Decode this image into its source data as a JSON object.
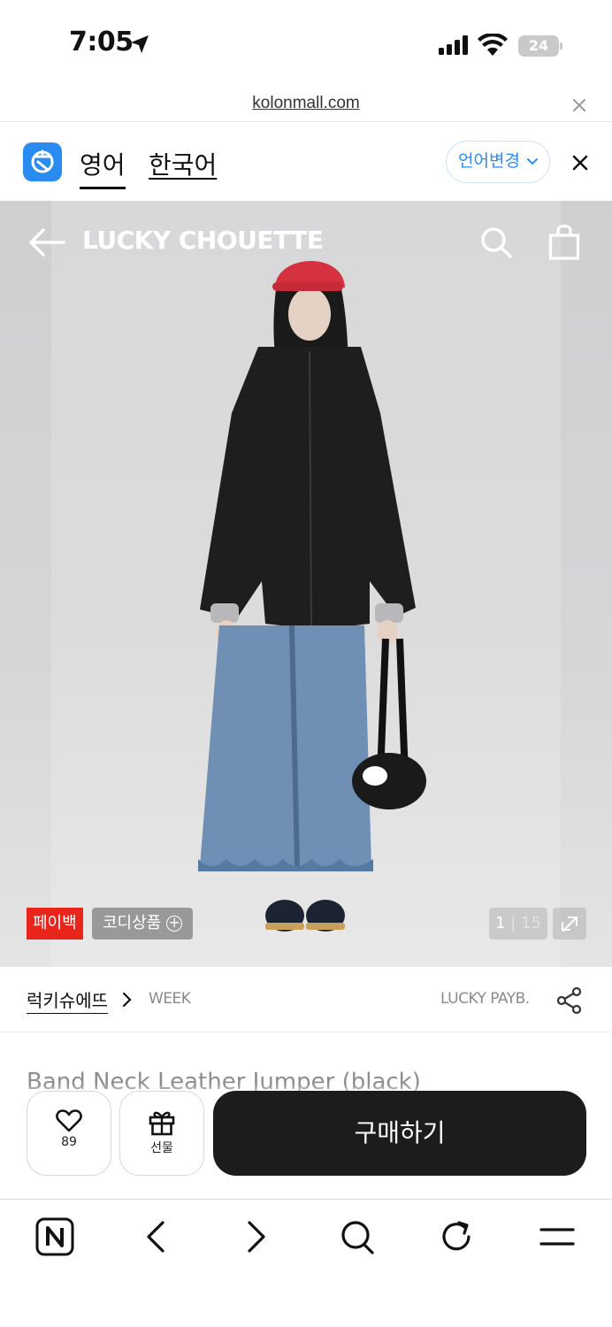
{
  "status_bar": {
    "time": "7:05",
    "battery": "24"
  },
  "url_bar": {
    "domain": "kolonmall.com"
  },
  "translate_bar": {
    "source_language": "영어",
    "target_language": "한국어",
    "change_language_label": "언어변경"
  },
  "header": {
    "brand_title": "LUCKY CHOUETTE"
  },
  "hero": {
    "payback_badge": "페이백",
    "codi_label": "코디상품",
    "current_image": "1",
    "image_separator": " | ",
    "total_images": "15"
  },
  "product_info": {
    "brand_name": "럭키슈에뜨",
    "season_label": "WEEK",
    "payback_label": "LUCKY PAYB.",
    "title": "Band Neck Leather Jumper (black)"
  },
  "actions": {
    "like_count": "89",
    "gift_label": "선물",
    "buy_label": "구매하기"
  },
  "colors": {
    "accent_blue": "#2a8cf0",
    "payback_red": "#e8241b",
    "buy_button": "#1c1c1c",
    "cap_red": "#d6313f"
  },
  "icons": [
    "location-arrow-icon",
    "signal-icon",
    "wifi-icon",
    "battery-icon",
    "close-icon",
    "translate-app-icon",
    "chevron-down-icon",
    "back-arrow-icon",
    "search-icon",
    "shopping-bag-icon",
    "expand-icon",
    "chevron-right-icon",
    "share-icon",
    "heart-icon",
    "gift-icon",
    "naver-icon",
    "back-icon",
    "forward-icon",
    "reload-icon",
    "menu-icon"
  ]
}
